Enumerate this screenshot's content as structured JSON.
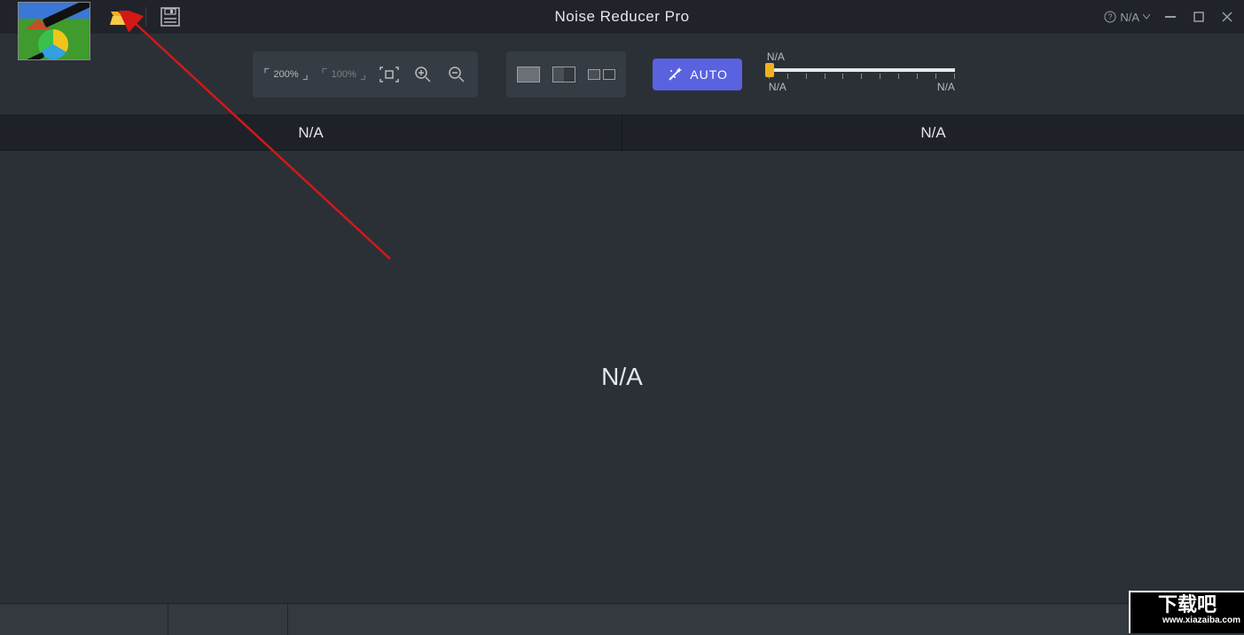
{
  "title": "Noise Reducer Pro",
  "help_menu_label": "N/A",
  "toolbar": {
    "zoom200": "200%",
    "zoom100": "100%",
    "auto_label": "AUTO",
    "slider": {
      "top_label": "N/A",
      "min_label": "N/A",
      "max_label": "N/A"
    }
  },
  "panels": {
    "left_label": "N/A",
    "right_label": "N/A"
  },
  "main_placeholder": "N/A",
  "watermark": {
    "big": "下载吧",
    "url": "www.xiazaiba.com"
  }
}
